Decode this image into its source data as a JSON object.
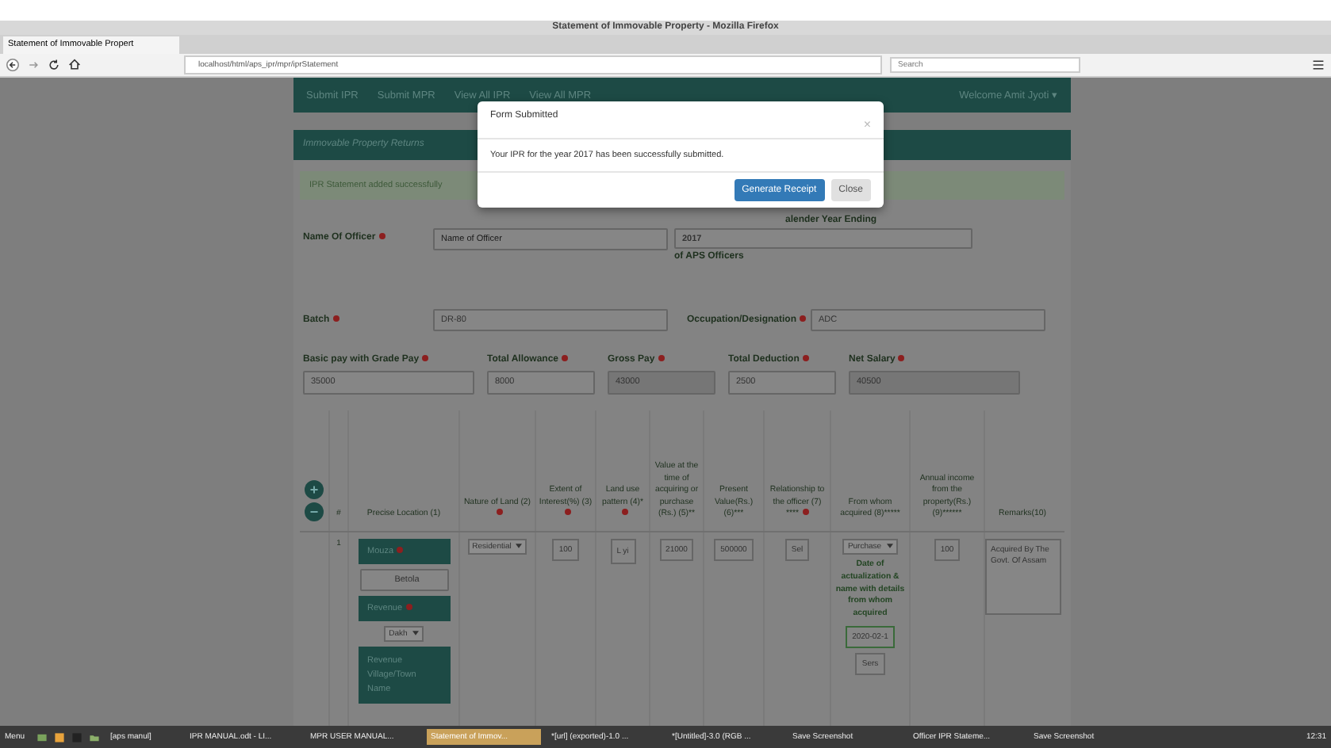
{
  "browser": {
    "title": "Statement of Immovable Property - Mozilla Firefox",
    "tab": "Statement of Immovable Propert",
    "url": "localhost/html/aps_ipr/mpr/iprStatement",
    "search_placeholder": "Search"
  },
  "nav": {
    "links": [
      "Submit IPR",
      "Submit MPR",
      "View All IPR",
      "View All MPR"
    ],
    "user": "Welcome Amit Jyoti ▾"
  },
  "panel": {
    "title": "Immovable Property Returns",
    "alert": "IPR Statement added successfully"
  },
  "form": {
    "officer": {
      "label": "Name Of Officer",
      "required": true,
      "placeholder": "Name of Officer"
    },
    "year": {
      "label": "alender Year Ending",
      "value": "2017",
      "note": "of APS Officers"
    },
    "batch": {
      "label": "Batch",
      "required": true,
      "value": "DR-80"
    },
    "occupation": {
      "label": "Occupation/Designation",
      "required": true,
      "value": "ADC"
    },
    "pay": [
      {
        "label": "Basic pay with Grade Pay",
        "required": true,
        "value": "35000",
        "readonly": false
      },
      {
        "label": "Total Allowance",
        "required": true,
        "value": "8000",
        "readonly": false
      },
      {
        "label": "Gross Pay",
        "required": true,
        "value": "43000",
        "readonly": true
      },
      {
        "label": "Total Deduction",
        "required": true,
        "value": "2500",
        "readonly": false
      },
      {
        "label": "Net Salary",
        "required": true,
        "value": "40500",
        "readonly": true
      }
    ]
  },
  "table": {
    "add": "+",
    "remove": "−",
    "columns": [
      {
        "label": "#",
        "required": false
      },
      {
        "label": "Precise Location (1)",
        "required": false
      },
      {
        "label": "Nature of Land (2)",
        "required": true
      },
      {
        "label": "Extent of Interest(%) (3)",
        "required": true
      },
      {
        "label": "Land use pattern (4)*",
        "required": true
      },
      {
        "label": "Value at the time of acquiring or purchase (Rs.) (5)**",
        "required": false
      },
      {
        "label": "Present Value(Rs.) (6)***",
        "required": false
      },
      {
        "label": "Relationship to the officer (7) ****",
        "required": true
      },
      {
        "label": "From whom acquired (8)*****",
        "required": false
      },
      {
        "label": "Annual income from the property(Rs.) (9)******",
        "required": false
      },
      {
        "label": "Remarks(10)",
        "required": false
      }
    ],
    "rows": [
      {
        "index": "1",
        "mouza_label": "Mouza",
        "mouza": "Betola",
        "revenue_label": "Revenue",
        "revenue": "Dakh",
        "village_label": "Revenue Village/Town Name",
        "nature": "Residential",
        "extent": "100",
        "land_use": "L yi",
        "value": "21000",
        "present": "500000",
        "relationship": "Sel",
        "from_whom": "Purchase",
        "date_note": "Date of actualization & name with details from whom acquired",
        "date": "2020-02-1",
        "details": "Sers",
        "income": "100",
        "remarks": "Acquired By The Govt. Of Assam"
      }
    ]
  },
  "modal": {
    "title": "Form Submitted",
    "close": "×",
    "message": "Your IPR for the year 2017 has been successfully submitted.",
    "buttons": [
      {
        "label": "Generate Receipt",
        "kind": "primary"
      },
      {
        "label": "Close",
        "kind": "default"
      }
    ]
  },
  "taskbar": {
    "menu": "Menu",
    "items": [
      {
        "label": "[aps manul]",
        "active": false
      },
      {
        "label": "IPR MANUAL.odt - LI...",
        "active": false
      },
      {
        "label": "MPR USER MANUAL...",
        "active": false
      },
      {
        "label": "Statement of Immov...",
        "active": true
      },
      {
        "label": "*[url] (exported)-1.0 ...",
        "active": false
      },
      {
        "label": "*[Untitled]-3.0 (RGB ...",
        "active": false
      },
      {
        "label": "Save Screenshot",
        "active": false
      },
      {
        "label": "Officer IPR Stateme...",
        "active": false
      },
      {
        "label": "Save Screenshot",
        "active": false
      }
    ],
    "clock": "12:31"
  }
}
